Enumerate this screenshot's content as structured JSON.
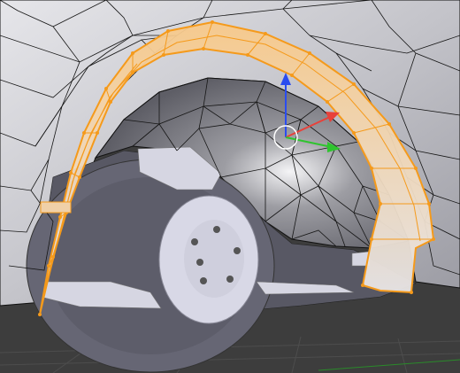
{
  "viewport": {
    "mode": "edit-mode-wireframe-overlay",
    "background_color": "#3d3d3d",
    "floor_color": "#474747",
    "mesh_color": "#c8c8cc",
    "wire_color": "#111111",
    "selection_color": "#f59a1b",
    "selection_fill": "#f5b04a"
  },
  "gizmo": {
    "type": "translate-manipulator",
    "axes": [
      {
        "name": "x",
        "color": "#e8413a"
      },
      {
        "name": "y",
        "color": "#2fc42f"
      },
      {
        "name": "z",
        "color": "#2a4cf0"
      }
    ],
    "pivot_color": "#ffffff"
  },
  "objects": {
    "wheel": {
      "lug_nuts": 6,
      "color": "#d8d8e6"
    },
    "selected_object": "wheel-arch"
  }
}
